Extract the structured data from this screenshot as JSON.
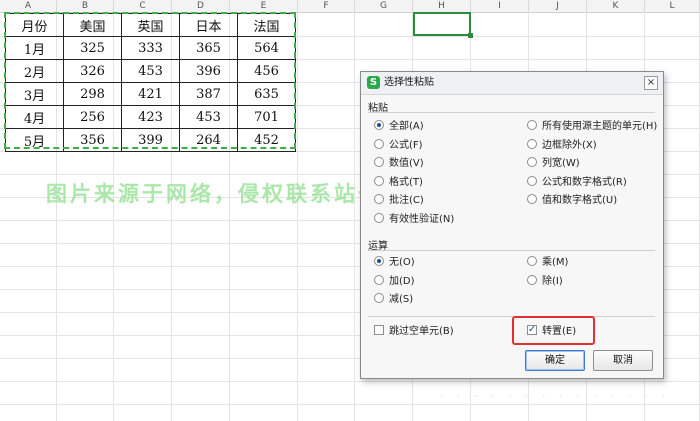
{
  "columns": [
    "A",
    "B",
    "C",
    "D",
    "E",
    "F",
    "G",
    "H",
    "I",
    "J",
    "K",
    "L"
  ],
  "table": {
    "headers": [
      "月份",
      "美国",
      "英国",
      "日本",
      "法国"
    ],
    "rows": [
      [
        "1月",
        "325",
        "333",
        "365",
        "564"
      ],
      [
        "2月",
        "326",
        "453",
        "396",
        "456"
      ],
      [
        "3月",
        "298",
        "421",
        "387",
        "635"
      ],
      [
        "4月",
        "256",
        "423",
        "453",
        "701"
      ],
      [
        "5月",
        "356",
        "399",
        "264",
        "452"
      ]
    ]
  },
  "watermark": "图片来源于网络，侵权联系站长删除！",
  "dialog": {
    "app_icon_letter": "S",
    "title": "选择性粘贴",
    "close": "×",
    "paste_label": "粘贴",
    "paste_left": [
      {
        "label": "全部(A)",
        "selected": true
      },
      {
        "label": "公式(F)",
        "selected": false
      },
      {
        "label": "数值(V)",
        "selected": false
      },
      {
        "label": "格式(T)",
        "selected": false
      },
      {
        "label": "批注(C)",
        "selected": false
      },
      {
        "label": "有效性验证(N)",
        "selected": false
      }
    ],
    "paste_right": [
      {
        "label": "所有使用源主题的单元(H)",
        "selected": false
      },
      {
        "label": "边框除外(X)",
        "selected": false
      },
      {
        "label": "列宽(W)",
        "selected": false
      },
      {
        "label": "公式和数字格式(R)",
        "selected": false
      },
      {
        "label": "值和数字格式(U)",
        "selected": false
      }
    ],
    "operation_label": "运算",
    "op_left": [
      {
        "label": "无(O)",
        "selected": true
      },
      {
        "label": "加(D)",
        "selected": false
      },
      {
        "label": "减(S)",
        "selected": false
      }
    ],
    "op_right": [
      {
        "label": "乘(M)",
        "selected": false
      },
      {
        "label": "除(I)",
        "selected": false
      }
    ],
    "skip_blanks": {
      "label": "跳过空单元(B)",
      "checked": false
    },
    "transpose": {
      "label": "转置(E)",
      "checked": true
    },
    "ok": "确定",
    "cancel": "取消"
  },
  "accent_colors": {
    "selection": "#3fae49",
    "highlight": "#e03030"
  }
}
